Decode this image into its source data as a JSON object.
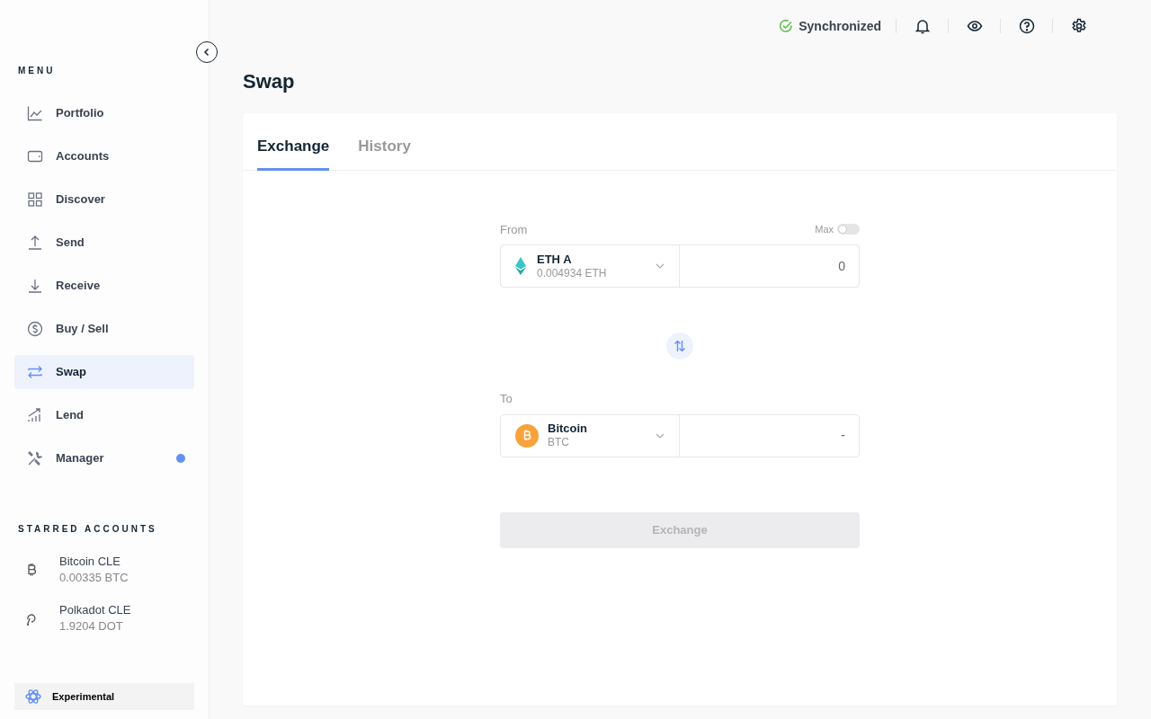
{
  "sidebar": {
    "menu_title": "MENU",
    "items": [
      {
        "label": "Portfolio",
        "selected": false,
        "notification": false
      },
      {
        "label": "Accounts",
        "selected": false,
        "notification": false
      },
      {
        "label": "Discover",
        "selected": false,
        "notification": false
      },
      {
        "label": "Send",
        "selected": false,
        "notification": false
      },
      {
        "label": "Receive",
        "selected": false,
        "notification": false
      },
      {
        "label": "Buy / Sell",
        "selected": false,
        "notification": false
      },
      {
        "label": "Swap",
        "selected": true,
        "notification": false
      },
      {
        "label": "Lend",
        "selected": false,
        "notification": false
      },
      {
        "label": "Manager",
        "selected": false,
        "notification": true
      }
    ],
    "starred_title": "STARRED ACCOUNTS",
    "starred": [
      {
        "name": "Bitcoin CLE",
        "balance": "0.00335 BTC"
      },
      {
        "name": "Polkadot CLE",
        "balance": "1.9204 DOT"
      }
    ],
    "experimental": "Experimental"
  },
  "topbar": {
    "sync_status": "Synchronized"
  },
  "page_title": "Swap",
  "tabs": [
    {
      "label": "Exchange",
      "selected": true
    },
    {
      "label": "History",
      "selected": false
    }
  ],
  "from": {
    "label": "From",
    "max_label": "Max",
    "max_on": false,
    "account": "ETH A",
    "balance": "0.004934 ETH",
    "amount": "0"
  },
  "to": {
    "label": "To",
    "currency": "Bitcoin",
    "ticker": "BTC",
    "amount": "-"
  },
  "exchange_button": {
    "label": "Exchange",
    "disabled": true
  }
}
